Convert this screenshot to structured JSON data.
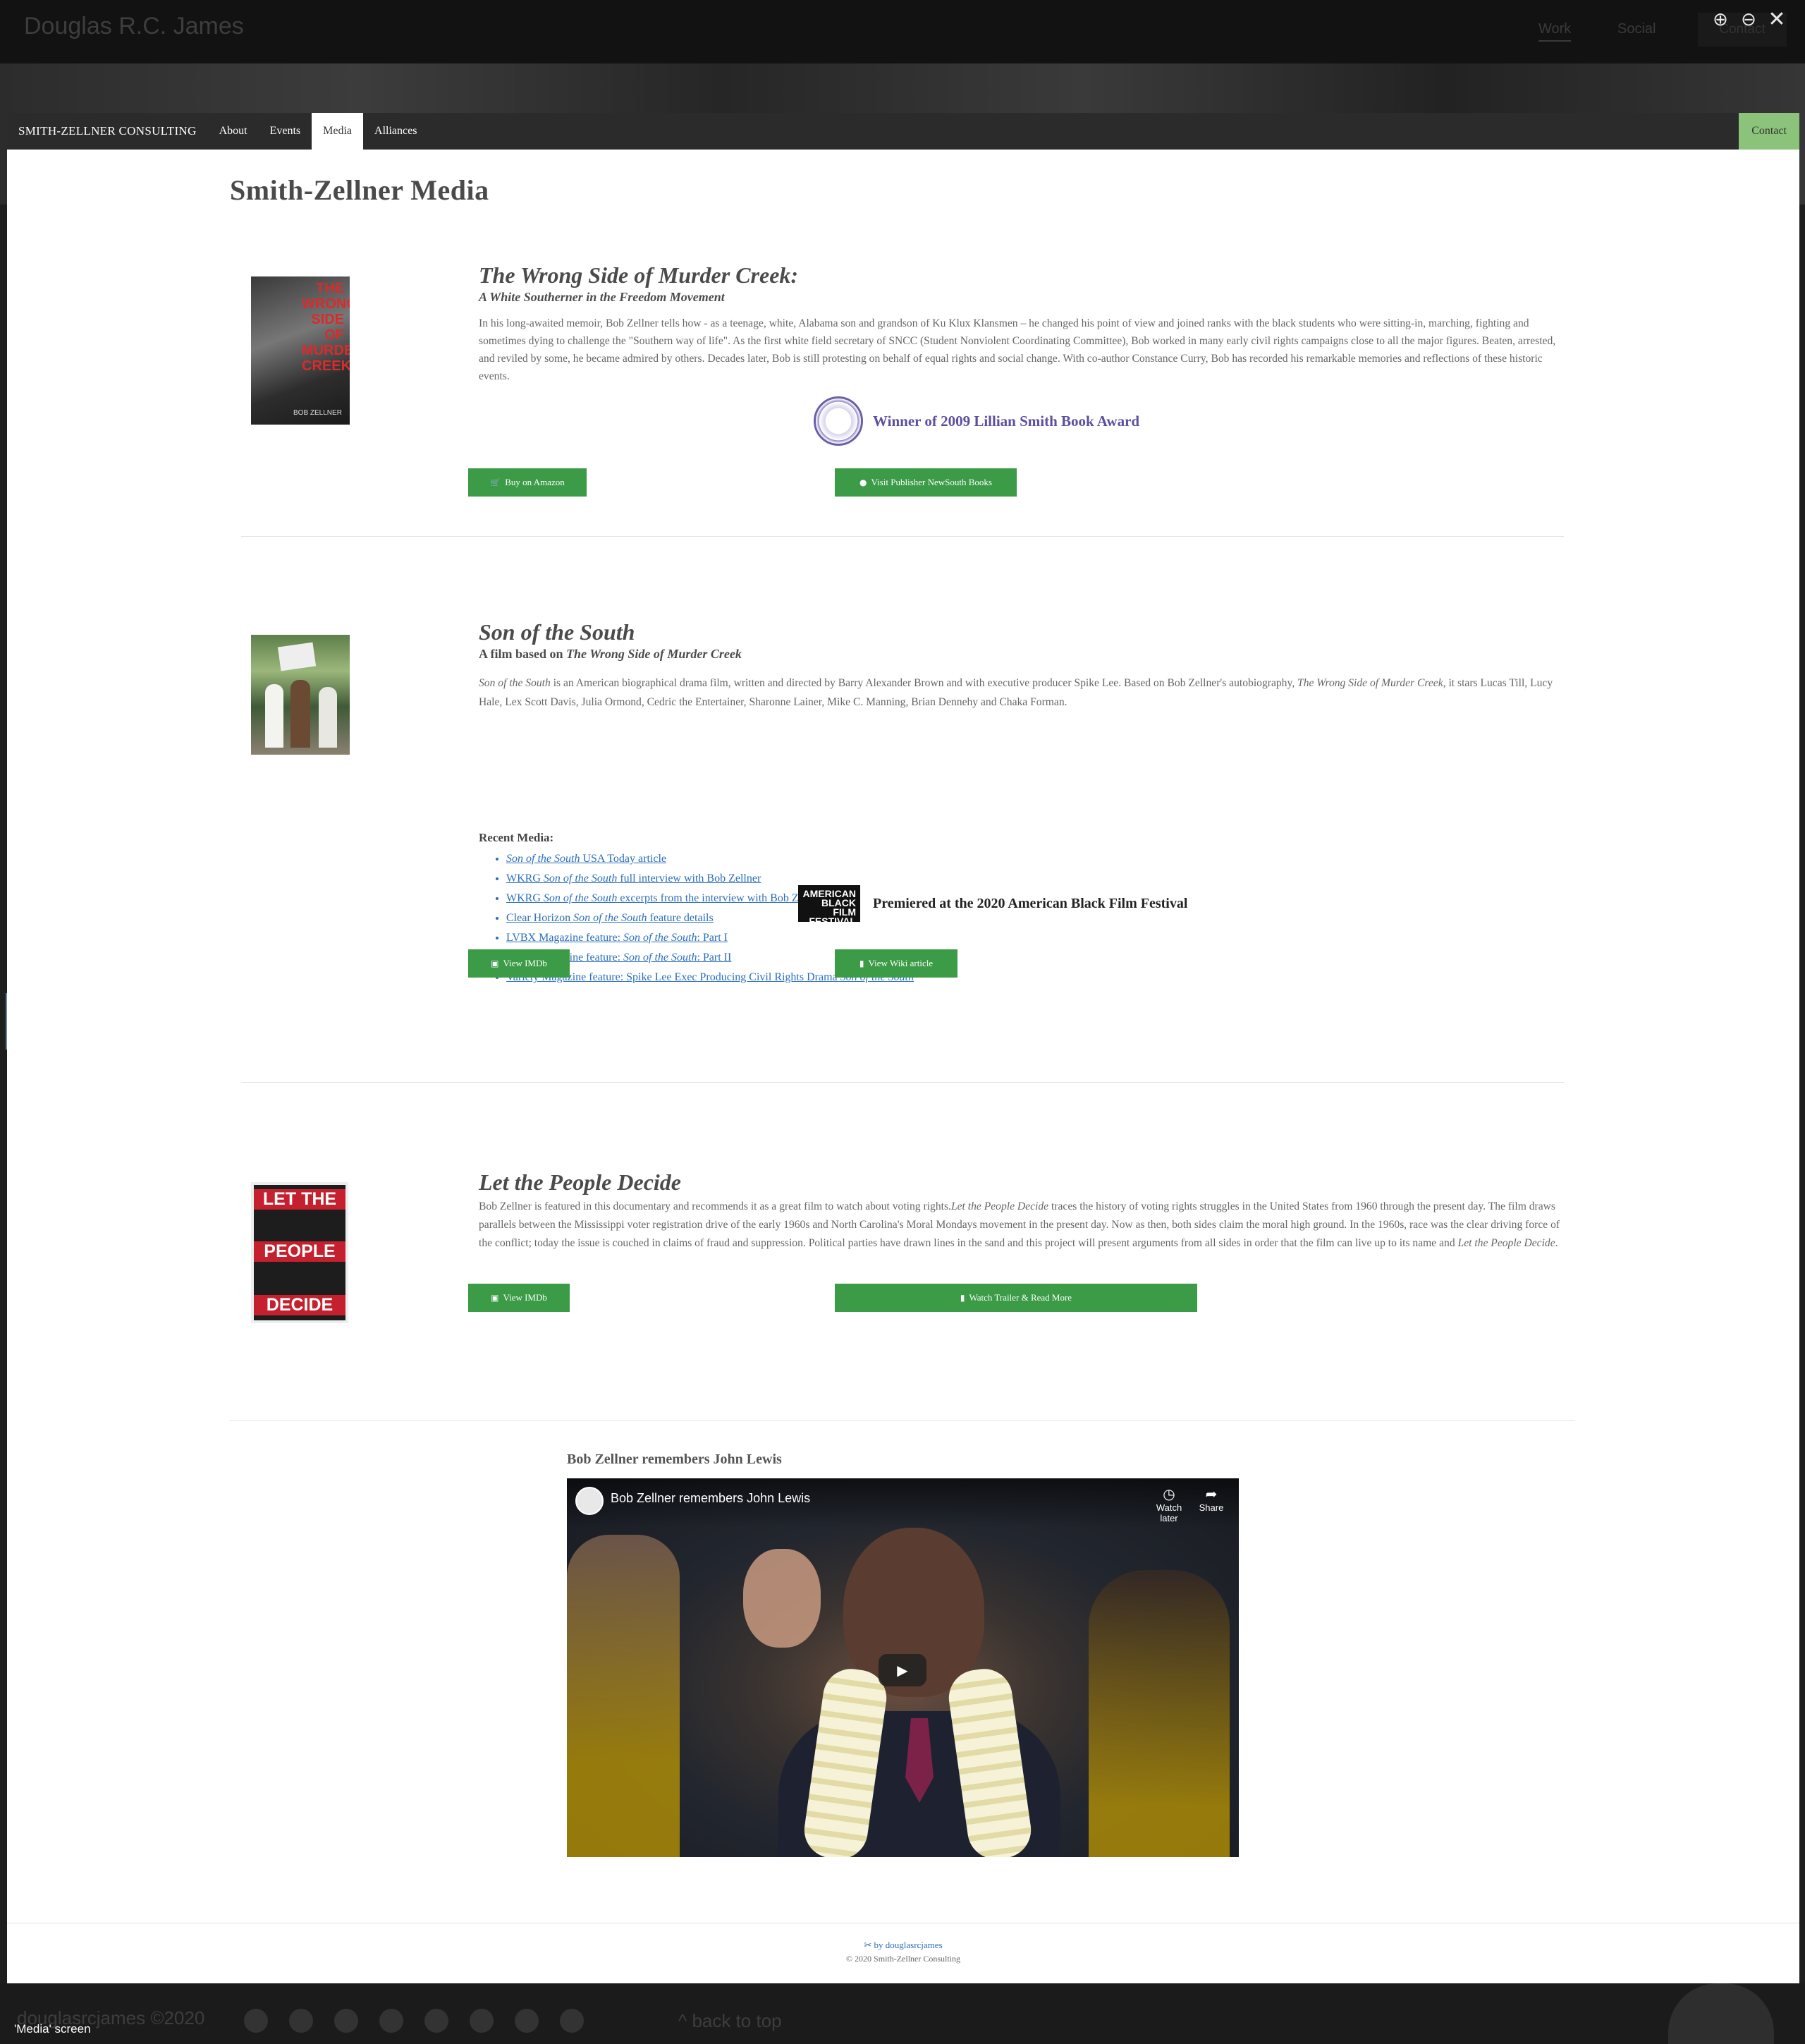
{
  "background": {
    "site_title": "Douglas R.C. James",
    "nav_work": "Work",
    "nav_social": "Social",
    "contact_label": "Contact",
    "copyright": "douglasrcjames ©2020",
    "back_to_top": "back to top"
  },
  "lightbox": {
    "zoom_in_icon": "⊕",
    "zoom_out_icon": "⊖",
    "close_icon": "✕",
    "prev_icon": "‹",
    "next_icon": "›",
    "caption": "'Media' screen"
  },
  "nav": {
    "brand": "SMITH-ZELLNER CONSULTING",
    "items": [
      {
        "label": "About"
      },
      {
        "label": "Events"
      },
      {
        "label": "Media"
      },
      {
        "label": "Alliances"
      }
    ],
    "active": "Media",
    "contact": "Contact"
  },
  "page_title": "Smith-Zellner Media",
  "book": {
    "cover_text": "THE WRONG SIDE OF MURDER CREEK",
    "cover_author": "BOB ZELLNER",
    "title": "The Wrong Side of Murder Creek:",
    "subtitle": "A White Southerner in the Freedom Movement",
    "description": "In his long-awaited memoir, Bob Zellner tells how - as a teenage, white, Alabama son and grandson of Ku Klux Klansmen – he changed his point of view and joined ranks with the black students who were sitting-in, marching, fighting and sometimes dying to challenge the \"Southern way of life\". As the first white field secretary of SNCC (Student Nonviolent Coordinating Committee), Bob worked in many early civil rights campaigns close to all the major figures. Beaten, arrested, and reviled by some, he became admired by others. Decades later, Bob is still protesting on behalf of equal rights and social change. With co-author Constance Curry, Bob has recorded his remarkable memories and reflections of these historic events.",
    "award": "Winner of 2009 Lillian Smith Book Award",
    "buy_button": "Buy on Amazon",
    "publisher_button": "Visit Publisher NewSouth Books"
  },
  "film": {
    "title": "Son of the South",
    "subtitle_prefix": "A film based on",
    "subtitle_book": "The Wrong Side of Murder Creek",
    "desc_film": "Son of the South",
    "desc_part1": " is an American biographical drama film, written and directed by Barry Alexander Brown and with executive producer Spike Lee. Based on Bob Zellner's autobiography, ",
    "desc_book": "The Wrong Side of Murder Creek",
    "desc_part2": ", it stars Lucas Till, Lucy Hale, Lex Scott Davis, Julia Ormond, Cedric the Entertainer, Sharonne Lainer, Mike C. Manning, Brian Dennehy and Chaka Forman.",
    "recent_media_label": "Recent Media:",
    "media_links": [
      {
        "pre": "",
        "em": "Son of the South",
        "post": " USA Today article"
      },
      {
        "pre": "WKRG ",
        "em": "Son of the South",
        "post": " full interview with Bob Zellner"
      },
      {
        "pre": "WKRG ",
        "em": "Son of the South",
        "post": " excerpts from the interview with Bob Zellner"
      },
      {
        "pre": "Clear Horizon ",
        "em": "Son of the South",
        "post": " feature details"
      },
      {
        "pre": "LVBX Magazine feature: ",
        "em": "Son of the South",
        "post": ": Part I"
      },
      {
        "pre": "LVBX Magazine feature: ",
        "em": "Son of the South",
        "post": ": Part II"
      },
      {
        "pre": "Variety Magazine feature: Spike Lee Exec Producing Civil Rights Drama ",
        "em": "Son of the South",
        "post": ""
      }
    ],
    "festival_logo": "AMERICAN BLACK FILM FESTIVAL",
    "festival": "Premiered at the 2020 American Black Film Festival",
    "imdb_button": "View IMDb",
    "wiki_button": "View Wiki article"
  },
  "doc": {
    "cover_words": [
      "LET THE",
      "PEOPLE",
      "DECIDE"
    ],
    "title": "Let the People Decide",
    "desc_part1": "Bob Zellner is featured in this documentary and recommends it as a great film to watch about voting rights.",
    "desc_em1": "Let the People Decide",
    "desc_part2": " traces the history of voting rights struggles in the United States from 1960 through the present day. The film draws parallels between the Mississippi voter registration drive of the early 1960s and North Carolina's Moral Mondays movement in the present day. Now as then, both sides claim the moral high ground. In the 1960s, race was the clear driving force of the conflict; today the issue is couched in claims of fraud and suppression. Political parties have drawn lines in the sand and this project will present arguments from all sides in order that the film can live up to its name and ",
    "desc_em2": "Let the People Decide",
    "desc_part3": ".",
    "imdb_button": "View IMDb",
    "trailer_button": "Watch Trailer & Read More"
  },
  "video": {
    "heading": "Bob Zellner remembers John Lewis",
    "title": "Bob Zellner remembers John Lewis",
    "watch_later": "Watch later",
    "share": "Share"
  },
  "footer": {
    "credit": "by douglasrcjames",
    "copyright": "© 2020 Smith-Zellner Consulting"
  },
  "colors": {
    "button_green": "#3b9b46",
    "contact_green": "#8cc37a",
    "link_blue": "#2a6ebb",
    "award_purple": "#5d4fa0"
  }
}
